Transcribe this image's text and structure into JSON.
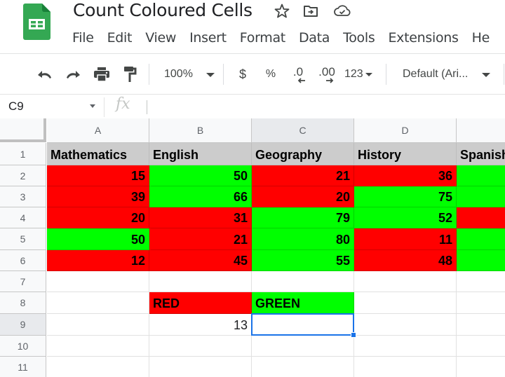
{
  "app": {
    "title": "Count Coloured Cells",
    "icons": {
      "logo": "google-sheets-logo",
      "star": "star-icon",
      "move": "move-to-folder-icon",
      "cloud": "cloud-saved-icon"
    }
  },
  "menu": [
    "File",
    "Edit",
    "View",
    "Insert",
    "Format",
    "Data",
    "Tools",
    "Extensions",
    "He"
  ],
  "toolbar": {
    "zoom": "100%",
    "currency": "$",
    "percent": "%",
    "decrease_decimal": ".0",
    "increase_decimal": ".00",
    "number_format": "123",
    "font": "Default (Ari...",
    "icons": [
      "undo-icon",
      "redo-icon",
      "print-icon",
      "paint-format-icon"
    ]
  },
  "formula_bar": {
    "name_box": "C9",
    "fx": "fx",
    "formula": ""
  },
  "grid": {
    "columns": [
      "A",
      "B",
      "C",
      "D",
      ""
    ],
    "selected_column": "C",
    "rows": [
      "1",
      "2",
      "3",
      "4",
      "5",
      "6",
      "7",
      "8",
      "9",
      "10",
      "11"
    ],
    "selected_row": "9",
    "selected_cell": "C9",
    "header_row": [
      "Mathematics",
      "English",
      "Geography",
      "History",
      "Spanish"
    ],
    "data_rows": [
      {
        "values": [
          "15",
          "50",
          "21",
          "36",
          ""
        ],
        "colors": [
          "red",
          "green",
          "red",
          "red",
          "green"
        ]
      },
      {
        "values": [
          "39",
          "66",
          "20",
          "75",
          ""
        ],
        "colors": [
          "red",
          "green",
          "red",
          "green",
          "green"
        ]
      },
      {
        "values": [
          "20",
          "31",
          "79",
          "52",
          ""
        ],
        "colors": [
          "red",
          "red",
          "green",
          "green",
          "red"
        ]
      },
      {
        "values": [
          "50",
          "21",
          "80",
          "11",
          ""
        ],
        "colors": [
          "green",
          "red",
          "green",
          "red",
          "green"
        ]
      },
      {
        "values": [
          "12",
          "45",
          "55",
          "48",
          ""
        ],
        "colors": [
          "red",
          "red",
          "green",
          "red",
          "green"
        ]
      }
    ],
    "summary": {
      "red_label": "RED",
      "green_label": "GREEN",
      "red_count": "13",
      "green_count": ""
    },
    "colors": {
      "red": "#ff0000",
      "green": "#00ff00",
      "header_fill": "#cccccc",
      "selection": "#1a73e8"
    }
  }
}
